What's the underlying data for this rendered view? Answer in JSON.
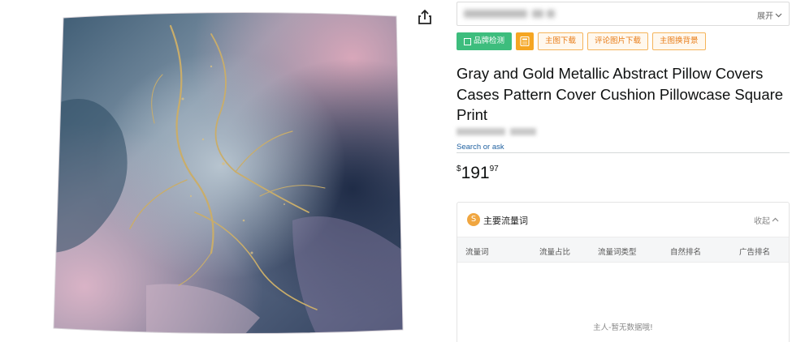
{
  "product_image": {
    "alt": "Gray and Gold Metallic Abstract Pillow Covers Cases Pattern Cover Cushion Pillowcase Square Print",
    "share_icon": "share-icon"
  },
  "seller_bar": {
    "expand_label": "展开",
    "expand_icon": "chevron-down-icon"
  },
  "tools": {
    "brand_check": "品牌检测",
    "calc_icon": "calculator-icon",
    "main_image_download": "主图下载",
    "review_image_download": "评论图片下载",
    "main_image_bg": "主图换背景"
  },
  "product": {
    "title": "Gray and Gold Metallic Abstract Pillow Covers Cases Pattern Cover Cushion Pillowcase Square Print",
    "search_or_ask": "Search or ask",
    "price": {
      "currency": "$",
      "whole": "191",
      "fraction": "97"
    }
  },
  "traffic_panel": {
    "icon_letter": "S",
    "title": "主要流量词",
    "collapse_label": "收起",
    "columns": [
      "流量词",
      "流量占比",
      "流量词类型",
      "自然排名",
      "广告排名"
    ],
    "empty_text": "主人-暂无数据哦!"
  },
  "colors": {
    "accent_green": "#3dbd7d",
    "accent_orange": "#e87c17",
    "link_blue": "#2162a1",
    "price_text": "#0f1111"
  }
}
